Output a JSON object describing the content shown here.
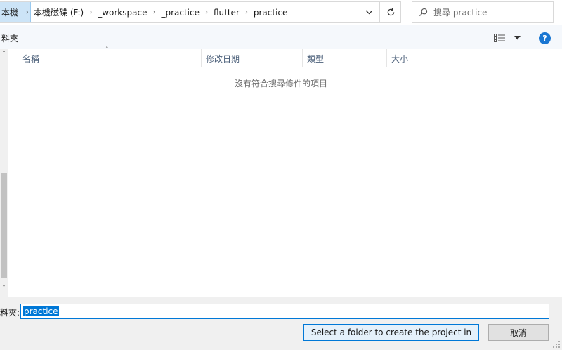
{
  "address_bar": {
    "root": "本機",
    "path": [
      "本機磁碟 (F:)",
      "_workspace",
      "_practice",
      "flutter",
      "practice"
    ],
    "separator": "›"
  },
  "search": {
    "placeholder": "搜尋 practice"
  },
  "command_bar": {
    "folder_label": "料夾"
  },
  "columns": {
    "name": "名稱",
    "modified": "修改日期",
    "type": "類型",
    "size": "大小"
  },
  "empty_message": "沒有符合搜尋條件的項目",
  "footer": {
    "folder_label": "料夾:",
    "folder_value": "practice",
    "select_button": "Select a folder to create the project in",
    "cancel_button": "取消"
  },
  "colors": {
    "accent": "#0078d7",
    "help": "#1976d2",
    "breadcrumb_highlight": "#cce4f7",
    "column_text": "#4c607a"
  },
  "icons": {
    "search": "search-icon",
    "refresh": "refresh-icon",
    "view": "view-options-icon",
    "help": "help-icon"
  }
}
